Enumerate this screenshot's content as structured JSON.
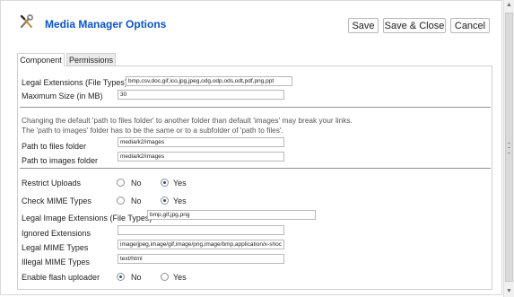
{
  "header": {
    "title": "Media Manager Options",
    "icon": "wrench-screwdriver-icon",
    "buttons": {
      "save": "Save",
      "save_close": "Save & Close",
      "cancel": "Cancel"
    }
  },
  "tabs": [
    {
      "label": "Component",
      "active": true
    },
    {
      "label": "Permissions",
      "active": false
    }
  ],
  "fields": {
    "legal_extensions": {
      "label": "Legal Extensions (File Types)",
      "value": "bmp,csv,doc,gif,ico,jpg,jpeg,odg,odp,ods,odt,pdf,png,ppt"
    },
    "max_size": {
      "label": "Maximum Size (in MB)",
      "value": "30"
    },
    "notes": [
      "Changing the default 'path to files folder' to another folder than default 'images' may break your links.",
      "The 'path to images' folder has to be the same or to a subfolder of 'path to files'."
    ],
    "path_files": {
      "label": "Path to files folder",
      "value": "media/k2/images"
    },
    "path_images": {
      "label": "Path to images folder",
      "value": "media/k2/images"
    },
    "restrict_uploads": {
      "label": "Restrict Uploads",
      "no": "No",
      "yes": "Yes",
      "selected": "Yes"
    },
    "check_mime": {
      "label": "Check MIME Types",
      "no": "No",
      "yes": "Yes",
      "selected": "Yes"
    },
    "legal_image_ext": {
      "label": "Legal Image Extensions (File Types)",
      "value": "bmp,gif,jpg,png"
    },
    "ignored_ext": {
      "label": "Ignored Extensions",
      "value": ""
    },
    "legal_mime": {
      "label": "Legal MIME Types",
      "value": "image/jpeg,image/gif,image/png,image/bmp,application/x-shockwave-flash"
    },
    "illegal_mime": {
      "label": "Illegal MIME Types",
      "value": "text/html"
    },
    "flash_uploader": {
      "label": "Enable flash uploader",
      "no": "No",
      "yes": "Yes",
      "selected": "No"
    }
  },
  "colors": {
    "title": "#0b55c4",
    "radio_dot": "#2a4f8a"
  }
}
